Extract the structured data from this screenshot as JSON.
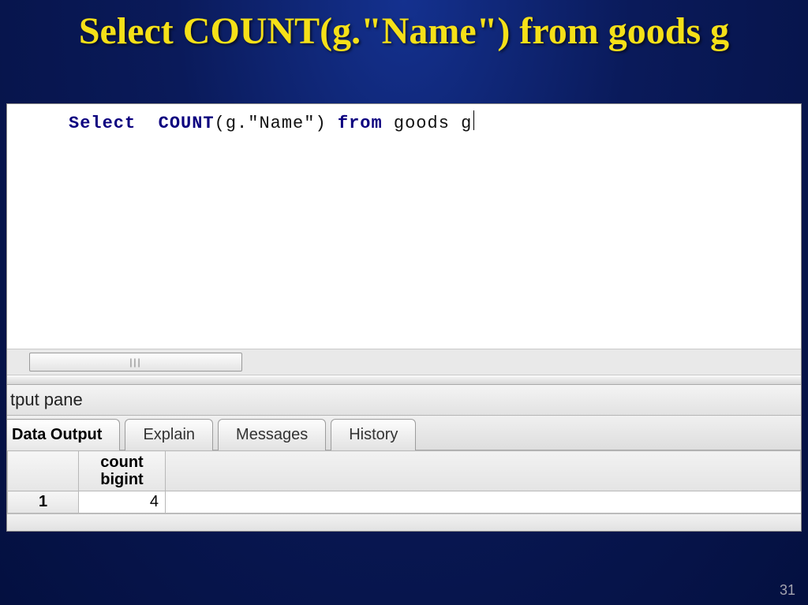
{
  "slide": {
    "title": "Select  COUNT(g.\"Name\") from goods g",
    "page_number": "31"
  },
  "sql": {
    "kw_select": "Select",
    "fn_count": "COUNT",
    "open": "(g.",
    "literal": "\"Name\"",
    "close": ")",
    "kw_from": "from",
    "table": "goods g"
  },
  "pane": {
    "label": "tput pane"
  },
  "tabs": {
    "data_output": "Data Output",
    "explain": "Explain",
    "messages": "Messages",
    "history": "History"
  },
  "results": {
    "col_name": "count",
    "col_type": "bigint",
    "rows": [
      {
        "num": "1",
        "value": "4"
      }
    ]
  }
}
